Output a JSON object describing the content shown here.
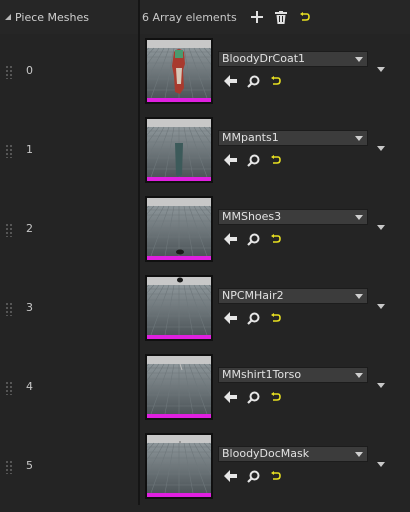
{
  "header": {
    "title": "Piece Meshes",
    "count_label": "6 Array elements",
    "add_icon": "plus-icon",
    "delete_icon": "trash-icon",
    "reset_icon": "reset-arrow-icon"
  },
  "colors": {
    "accent_magenta": "#e020e0",
    "reset_yellow": "#e8e020",
    "background": "#242424",
    "combo_bg": "#3c3c3c"
  },
  "elements": [
    {
      "index": "0",
      "mesh": "BloodyDrCoat1"
    },
    {
      "index": "1",
      "mesh": "MMpants1"
    },
    {
      "index": "2",
      "mesh": "MMShoes3"
    },
    {
      "index": "3",
      "mesh": "NPCMHair2"
    },
    {
      "index": "4",
      "mesh": "MMshirt1Torso"
    },
    {
      "index": "5",
      "mesh": "BloodyDocMask"
    }
  ]
}
